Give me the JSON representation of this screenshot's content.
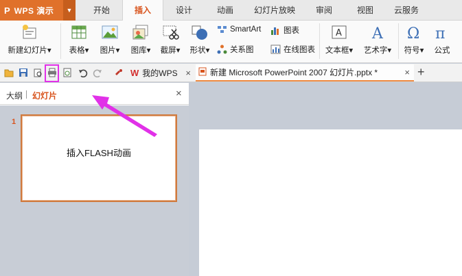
{
  "app": {
    "logo": "P",
    "name": "WPS 演示",
    "dropdown": "▼"
  },
  "menu_tabs": [
    "开始",
    "插入",
    "设计",
    "动画",
    "幻灯片放映",
    "审阅",
    "视图",
    "云服务"
  ],
  "active_tab_index": 1,
  "ribbon": {
    "new_slide": "新建幻灯片",
    "table": "表格",
    "image": "图片",
    "gallery": "图库",
    "screenshot": "截屏",
    "shape": "形状",
    "smartart": "SmartArt",
    "chart": "图表",
    "relation": "关系图",
    "online_chart": "在线图表",
    "textbox": "文本框",
    "wordart": "艺术字",
    "symbol": "符号",
    "formula": "公式",
    "dropdown_mark": "▾"
  },
  "doc_tabs": [
    {
      "label": "我的WPS",
      "close": "×"
    },
    {
      "label": "新建 Microsoft PowerPoint 2007 幻灯片.pptx *",
      "close": "×"
    }
  ],
  "new_tab": "+",
  "panel": {
    "outline_tab": "大纲",
    "slides_tab": "幻灯片",
    "close": "×",
    "slides": [
      {
        "number": "1",
        "text": "插入FLASH动画"
      }
    ]
  },
  "colors": {
    "accent": "#d8531c",
    "app_button": "#e0712b",
    "highlight": "#e131e8",
    "workspace": "#c6ccd6"
  }
}
